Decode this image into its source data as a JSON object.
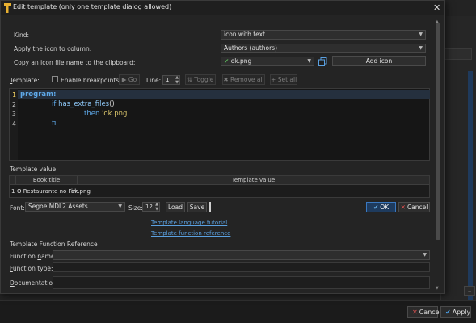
{
  "dialog": {
    "title": "Edit template (only one template dialog allowed)"
  },
  "form": {
    "kind_label": "Kind:",
    "kind_value": "icon with text",
    "apply_label": "Apply the icon to column:",
    "apply_value": "Authors (authors)",
    "copy_label": "Copy an icon file name to the clipboard:",
    "icon_file_value": "ok.png",
    "add_icon_label": "Add icon"
  },
  "toolbar": {
    "template_label": "Template:",
    "enable_breakpoints_label": "Enable breakpoints",
    "go_label": "Go",
    "line_label": "Line:",
    "line_value": "1",
    "toggle_label": "Toggle",
    "remove_all_label": "Remove all",
    "set_all_label": "Set all"
  },
  "editor": {
    "line_numbers": [
      "1",
      "2",
      "3",
      "4"
    ],
    "line1": "program:",
    "line2_kw": "if",
    "line2_fn": "has_extra_files",
    "line2_paren": "()",
    "line3_kw": "then",
    "line3_str": "'ok.png'",
    "line4_kw": "fi"
  },
  "template_value": {
    "label": "Template value:",
    "columns": [
      "Book title",
      "Template value"
    ],
    "row_number": "1",
    "row_title": "O Restaurante no Fim",
    "row_value": "ok.png"
  },
  "font_row": {
    "font_label": "Font:",
    "font_value": "Segoe MDL2 Assets",
    "size_label": "Size:",
    "size_value": "12",
    "load_label": "Load",
    "save_label": "Save",
    "ok_label": "OK",
    "cancel_label": "Cancel"
  },
  "links": {
    "tutorial": "Template language tutorial",
    "reference": "Template function reference"
  },
  "reference": {
    "heading": "Template Function Reference",
    "function_name_label": "Function name:",
    "function_type_label": "Function type:",
    "documentation_label": "Documentation:"
  },
  "background": {
    "cancel_label": "Cancel",
    "apply_label": "Apply"
  },
  "colors": {
    "keyword": "#5ea8e8",
    "string": "#d6c26a",
    "link": "#5aa0e0",
    "ok_accent": "#3a78c0"
  }
}
